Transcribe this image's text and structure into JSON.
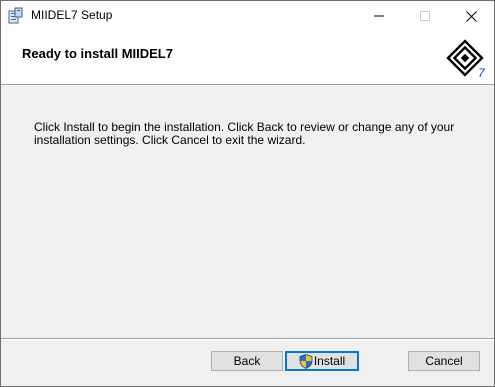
{
  "window": {
    "title": "MIIDEL7 Setup"
  },
  "banner": {
    "title": "Ready to install MIIDEL7",
    "logo_icon": "miidel7-logo-icon"
  },
  "main": {
    "description": "Click Install to begin the installation. Click Back to review or change any of your installation settings. Click Cancel to exit the wizard."
  },
  "buttons": {
    "back": "Back",
    "install": "Install",
    "cancel": "Cancel"
  },
  "colors": {
    "accent": "#0078d7",
    "button_face": "#e1e1e1",
    "background": "#f0f0f0"
  }
}
